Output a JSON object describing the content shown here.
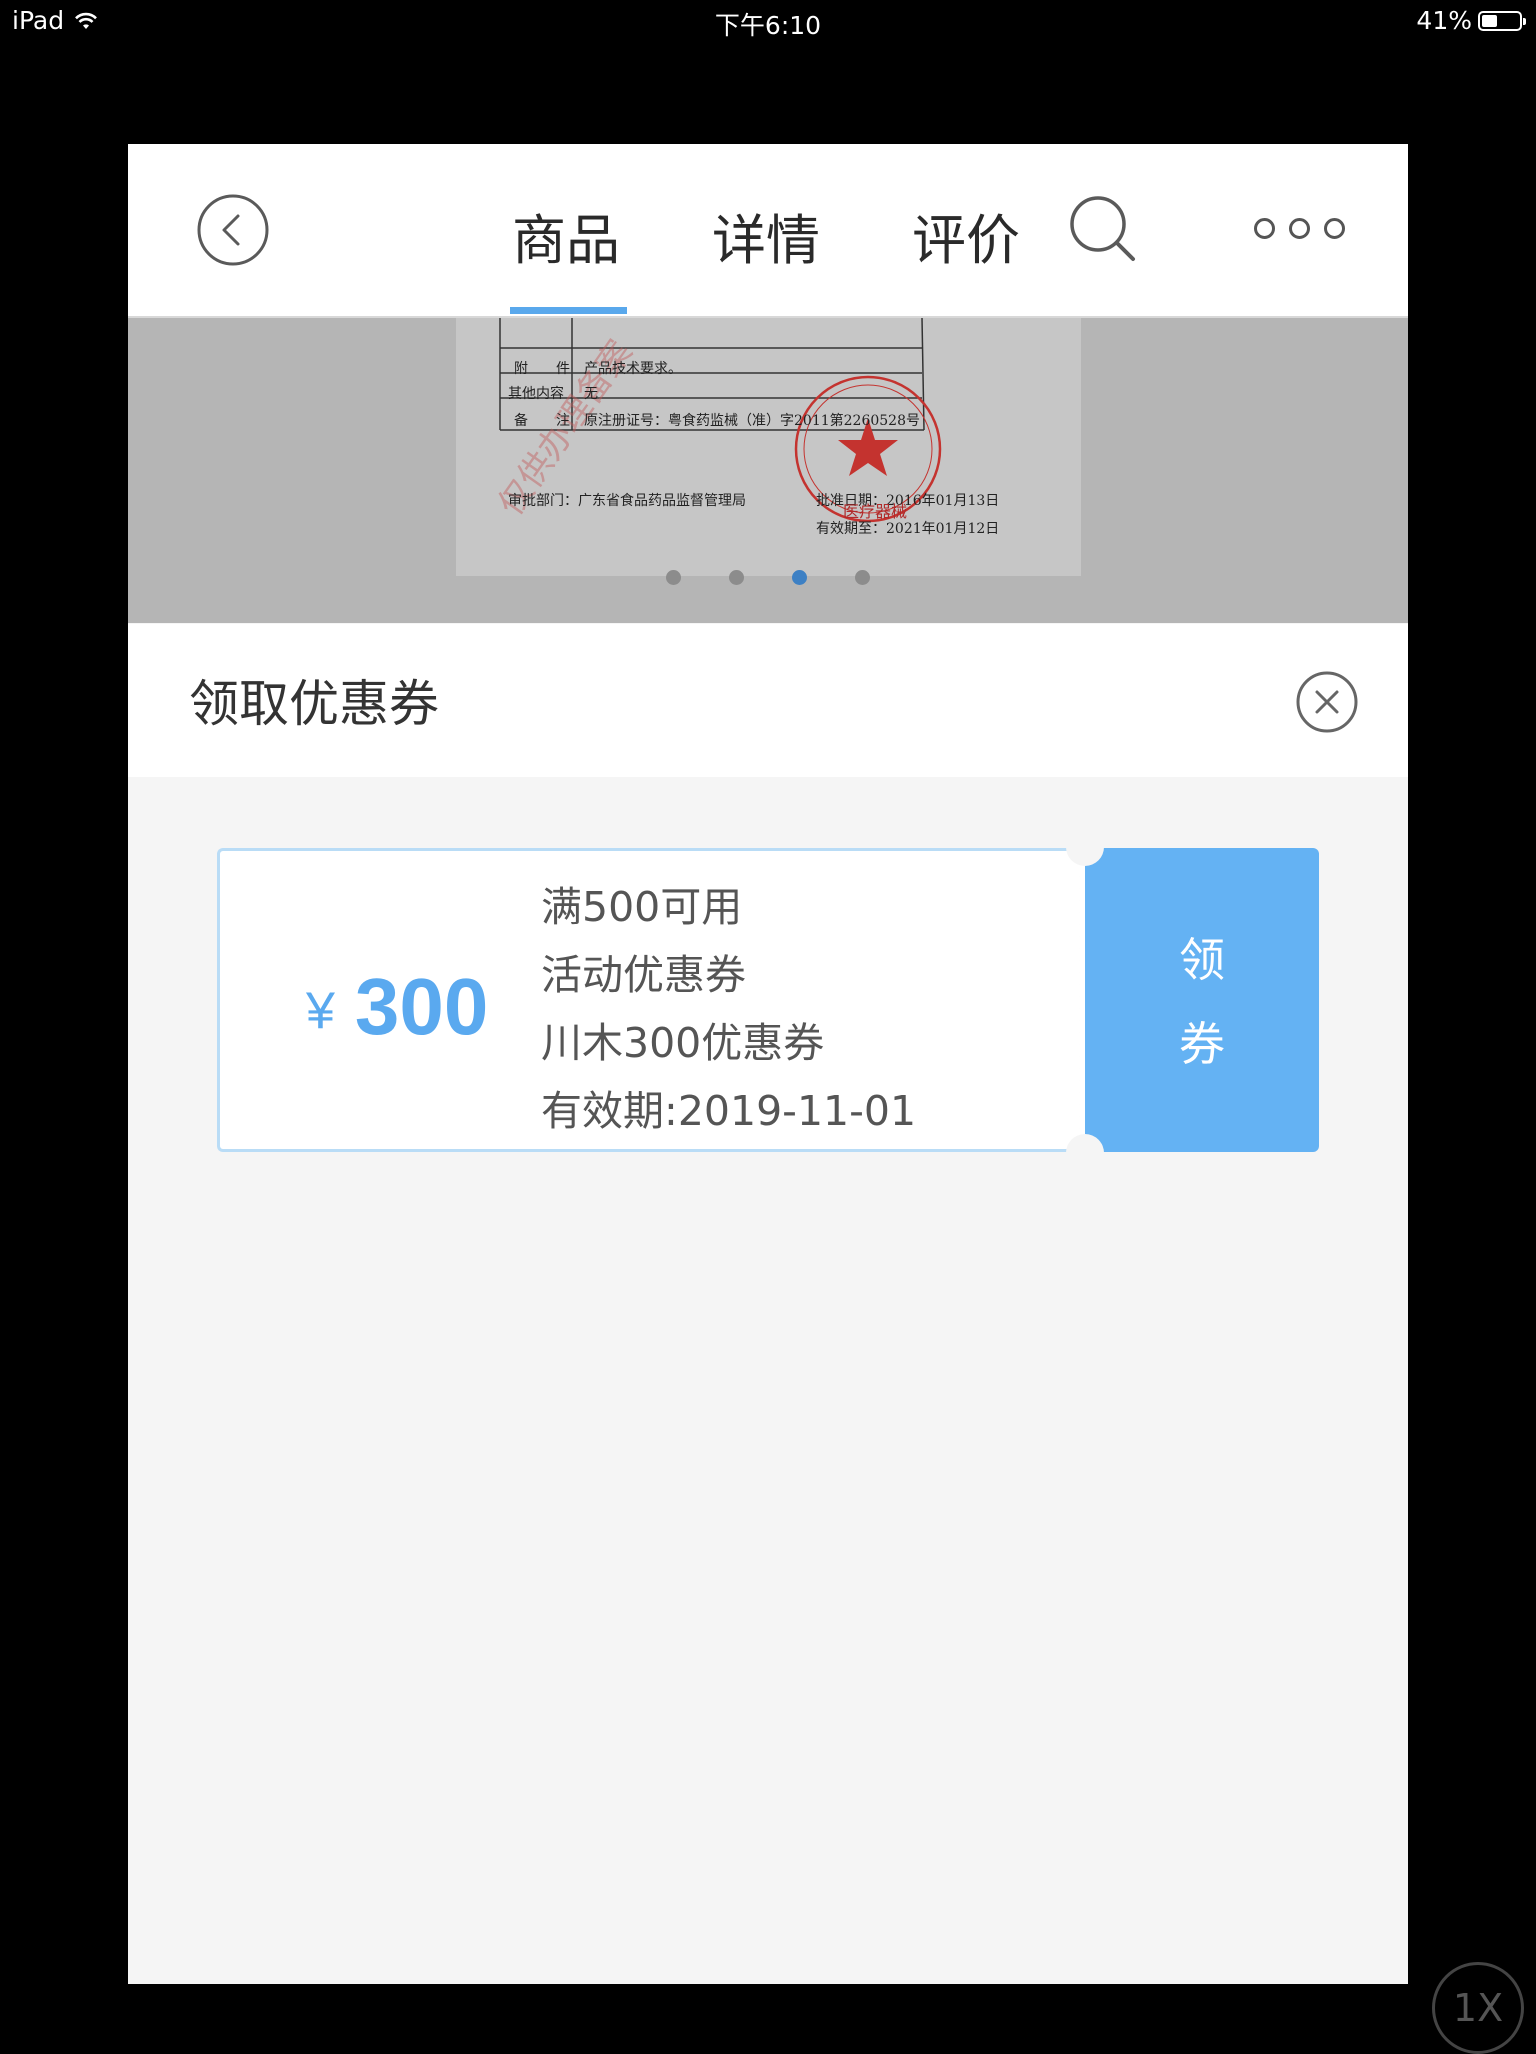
{
  "status_bar": {
    "device": "iPad",
    "time": "下午6:10",
    "battery_percent": "41%",
    "battery_level": 0.41,
    "wifi_icon": "wifi-icon"
  },
  "nav": {
    "back_icon": "chevron-left-circle-icon",
    "tabs": [
      {
        "label": "商品",
        "active": true
      },
      {
        "label": "详情",
        "active": false
      },
      {
        "label": "评价",
        "active": false
      }
    ],
    "search_icon": "search-icon",
    "more_icon": "more-dots-icon"
  },
  "banner": {
    "doc_lines": {
      "attachment_label": "附　　件",
      "attachment_value": "产品技术要求。",
      "other_label": "其他内容",
      "other_value": "无",
      "remark_label": "备　　注",
      "remark_value": "原注册证号：粤食药监械（准）字2011第2260528号",
      "dept": "审批部门：广东省食品药品监督管理局",
      "approval_date": "批准日期：2016年01月13日",
      "valid_until": "有效期至：2021年01月12日",
      "seal_text": "医疗器械"
    },
    "carousel_count": 4,
    "carousel_active_index": 2,
    "accent_color": "#3d80c4"
  },
  "sheet": {
    "title": "领取优惠券",
    "close_icon": "close-circle-icon"
  },
  "coupon": {
    "currency": "¥",
    "amount": "300",
    "condition": "满500可用",
    "type": "活动优惠券",
    "name": "川木300优惠券",
    "validity": "有效期:2019-11-01",
    "claim_line1": "领",
    "claim_line2": "券",
    "accent_color": "#64b2f3"
  },
  "overlay": {
    "speed": "1X"
  }
}
